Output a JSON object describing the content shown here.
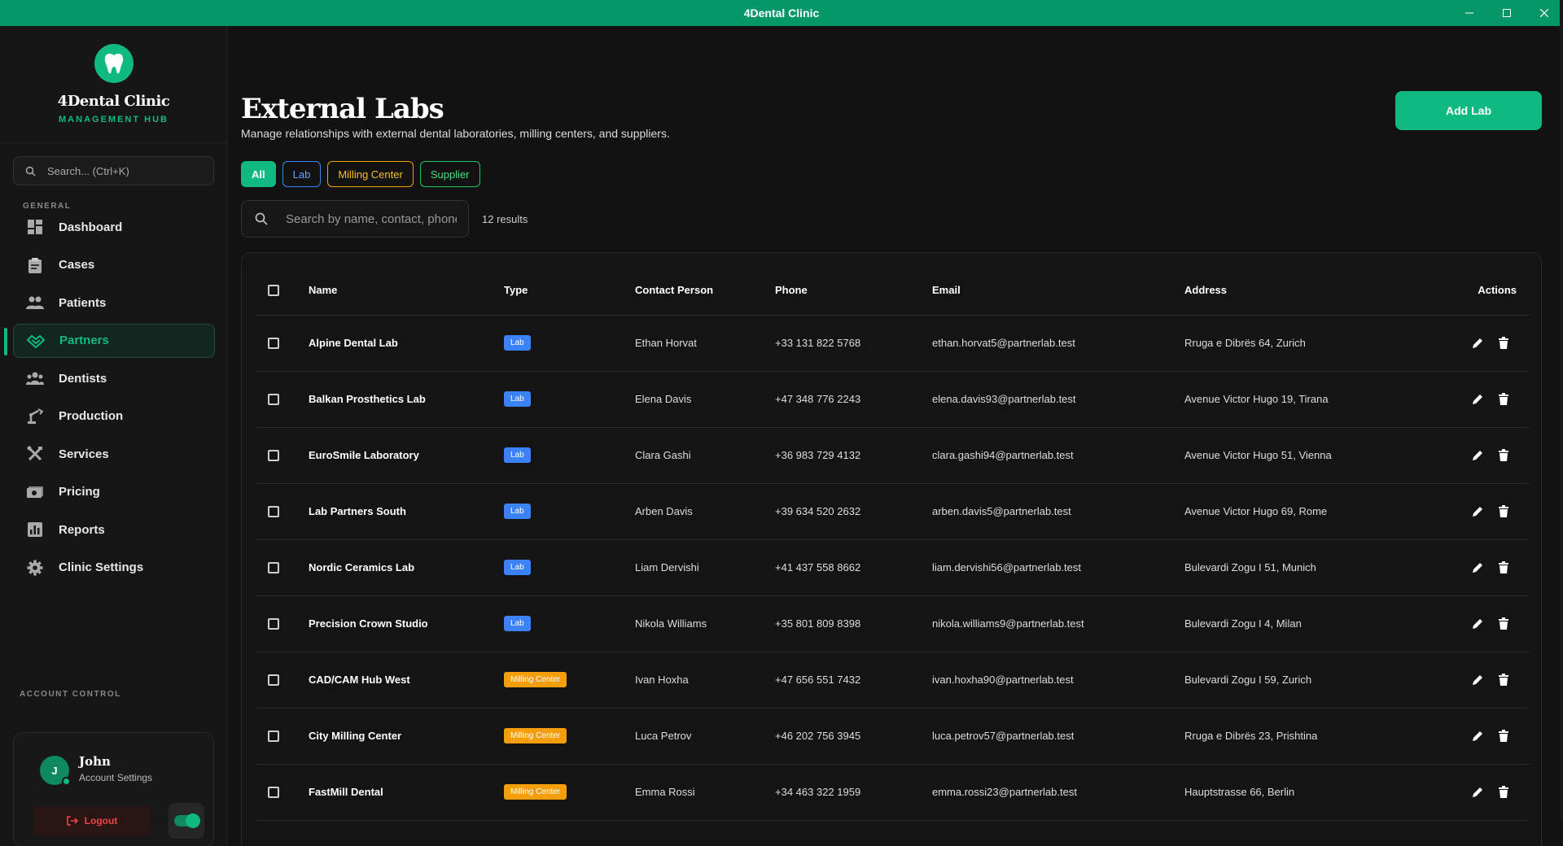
{
  "window": {
    "title": "4Dental Clinic"
  },
  "brand": {
    "name": "4Dental Clinic",
    "subtitle": "MANAGEMENT HUB"
  },
  "sidebar": {
    "search_placeholder": "Search... (Ctrl+K)",
    "section_general": "GENERAL",
    "items": [
      {
        "label": "Dashboard",
        "icon": "dashboard-icon"
      },
      {
        "label": "Cases",
        "icon": "clipboard-icon"
      },
      {
        "label": "Patients",
        "icon": "people-icon"
      },
      {
        "label": "Partners",
        "icon": "handshake-icon",
        "active": true
      },
      {
        "label": "Dentists",
        "icon": "group-icon"
      },
      {
        "label": "Production",
        "icon": "robot-arm-icon"
      },
      {
        "label": "Services",
        "icon": "tools-icon"
      },
      {
        "label": "Pricing",
        "icon": "money-icon"
      },
      {
        "label": "Reports",
        "icon": "chart-icon"
      },
      {
        "label": "Clinic Settings",
        "icon": "gear-icon"
      }
    ],
    "section_account": "ACCOUNT CONTROL",
    "account": {
      "initial": "J",
      "name": "John",
      "sub": "Account Settings",
      "logout": "Logout"
    }
  },
  "page": {
    "title": "External Labs",
    "subtitle": "Manage relationships with external dental laboratories, milling centers, and suppliers.",
    "add_button": "Add Lab",
    "filters": [
      "All",
      "Lab",
      "Milling Center",
      "Supplier"
    ],
    "search_placeholder": "Search by name, contact, phone...",
    "results": "12 results"
  },
  "table": {
    "columns": [
      "Name",
      "Type",
      "Contact Person",
      "Phone",
      "Email",
      "Address",
      "Actions"
    ],
    "rows": [
      {
        "name": "Alpine Dental Lab",
        "type": "Lab",
        "contact": "Ethan Horvat",
        "phone": "+33 131 822 5768",
        "email": "ethan.horvat5@partnerlab.test",
        "address": "Rruga e Dibrës 64, Zurich"
      },
      {
        "name": "Balkan Prosthetics Lab",
        "type": "Lab",
        "contact": "Elena Davis",
        "phone": "+47 348 776 2243",
        "email": "elena.davis93@partnerlab.test",
        "address": "Avenue Victor Hugo 19, Tirana"
      },
      {
        "name": "EuroSmile Laboratory",
        "type": "Lab",
        "contact": "Clara Gashi",
        "phone": "+36 983 729 4132",
        "email": "clara.gashi94@partnerlab.test",
        "address": "Avenue Victor Hugo 51, Vienna"
      },
      {
        "name": "Lab Partners South",
        "type": "Lab",
        "contact": "Arben Davis",
        "phone": "+39 634 520 2632",
        "email": "arben.davis5@partnerlab.test",
        "address": "Avenue Victor Hugo 69, Rome"
      },
      {
        "name": "Nordic Ceramics Lab",
        "type": "Lab",
        "contact": "Liam Dervishi",
        "phone": "+41 437 558 8662",
        "email": "liam.dervishi56@partnerlab.test",
        "address": "Bulevardi Zogu I 51, Munich"
      },
      {
        "name": "Precision Crown Studio",
        "type": "Lab",
        "contact": "Nikola Williams",
        "phone": "+35 801 809 8398",
        "email": "nikola.williams9@partnerlab.test",
        "address": "Bulevardi Zogu I 4, Milan"
      },
      {
        "name": "CAD/CAM Hub West",
        "type": "Milling Center",
        "contact": "Ivan Hoxha",
        "phone": "+47 656 551 7432",
        "email": "ivan.hoxha90@partnerlab.test",
        "address": "Bulevardi Zogu I 59, Zurich"
      },
      {
        "name": "City Milling Center",
        "type": "Milling Center",
        "contact": "Luca Petrov",
        "phone": "+46 202 756 3945",
        "email": "luca.petrov57@partnerlab.test",
        "address": "Rruga e Dibrës 23, Prishtina"
      },
      {
        "name": "FastMill Dental",
        "type": "Milling Center",
        "contact": "Emma Rossi",
        "phone": "+34 463 322 1959",
        "email": "emma.rossi23@partnerlab.test",
        "address": "Hauptstrasse 66, Berlin"
      }
    ]
  },
  "colors": {
    "accent": "#10b981",
    "titlebar": "#059669",
    "lab": "#3b82f6",
    "milling": "#f59e0b",
    "supplier": "#22c55e",
    "danger": "#ef4444"
  }
}
